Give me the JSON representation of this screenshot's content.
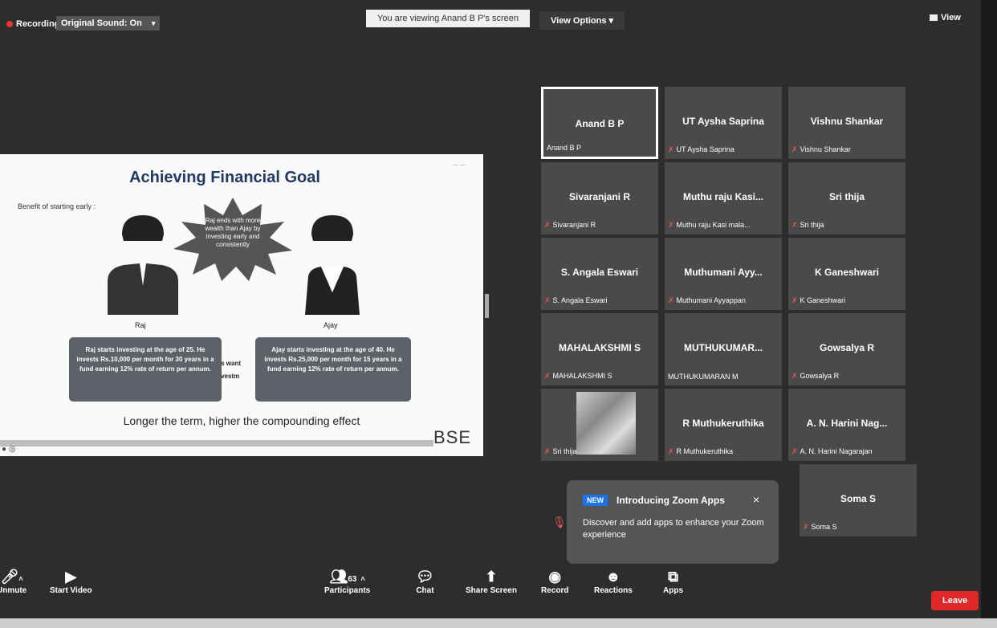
{
  "topbar": {
    "recording": "Recording",
    "original_sound": "Original Sound: On",
    "viewing": "You are viewing Anand B P's screen",
    "view_options": "View Options",
    "view": "View"
  },
  "slide": {
    "title": "Achieving Financial Goal",
    "benefit": "Benefit of starting early :",
    "burst_text": "Raj ends with more wealth than Ajay by investing early and consistently",
    "raj_label": "Raj",
    "ajay_label": "Ajay",
    "raj_box": "Raj starts investing at the age of 25. He invests Rs.10,000 per month for 30 years in a fund earning 12% rate of return per annum.",
    "ajay_box": "Ajay starts investing at the age of 40. He invests Rs.25,000 per month for 15 years in a fund earning 12% rate of return per annum.",
    "mid1": "rs want",
    "mid2": "investm",
    "footer": "Longer the term, higher the compounding effect",
    "logo": "BSE"
  },
  "participants_grid": [
    {
      "name": "Anand B P",
      "sub": "Anand B P",
      "muted": false,
      "active": true
    },
    {
      "name": "UT Aysha Saprina",
      "sub": "UT Aysha Saprina",
      "muted": true
    },
    {
      "name": "Vishnu Shankar",
      "sub": "Vishnu Shankar",
      "muted": true
    },
    {
      "name": "Sivaranjani R",
      "sub": "Sivaranjani R",
      "muted": true
    },
    {
      "name": "Muthu raju Kasi...",
      "sub": "Muthu raju Kasi mala...",
      "muted": true
    },
    {
      "name": "Sri thija",
      "sub": "Sri thija",
      "muted": true
    },
    {
      "name": "S. Angala Eswari",
      "sub": "S. Angala Eswari",
      "muted": true
    },
    {
      "name": "Muthumani Ayy...",
      "sub": "Muthumani Ayyappan",
      "muted": true
    },
    {
      "name": "K Ganeshwari",
      "sub": "K Ganeshwari",
      "muted": true
    },
    {
      "name": "MAHALAKSHMI S",
      "sub": "MAHALAKSHMI S",
      "muted": true
    },
    {
      "name": "MUTHUKUMAR...",
      "sub": "MUTHUKUMARAN M",
      "muted": false
    },
    {
      "name": "Gowsalya R",
      "sub": "Gowsalya R",
      "muted": true
    },
    {
      "name": "",
      "sub": "Sri thija",
      "muted": true,
      "photo": true
    },
    {
      "name": "R Muthukeruthika",
      "sub": "R Muthukeruthika",
      "muted": true
    },
    {
      "name": "A. N. Harini Nag...",
      "sub": "A. N. Harini Nagarajan",
      "muted": true
    },
    {
      "name": "Soma S",
      "sub": "Soma S",
      "muted": true
    }
  ],
  "popup": {
    "badge": "NEW",
    "title": "Introducing Zoom Apps",
    "close": "×",
    "body": "Discover and add apps to enhance your Zoom experience"
  },
  "toolbar": {
    "unmute": "Unmute",
    "start_video": "Start Video",
    "participants": "Participants",
    "participants_count": "63",
    "chat": "Chat",
    "share_screen": "Share Screen",
    "record": "Record",
    "reactions": "Reactions",
    "apps": "Apps",
    "leave": "Leave"
  },
  "colors": {
    "accent": "#1a73e8",
    "leave": "#e02828",
    "slide_title": "#1f3864"
  }
}
